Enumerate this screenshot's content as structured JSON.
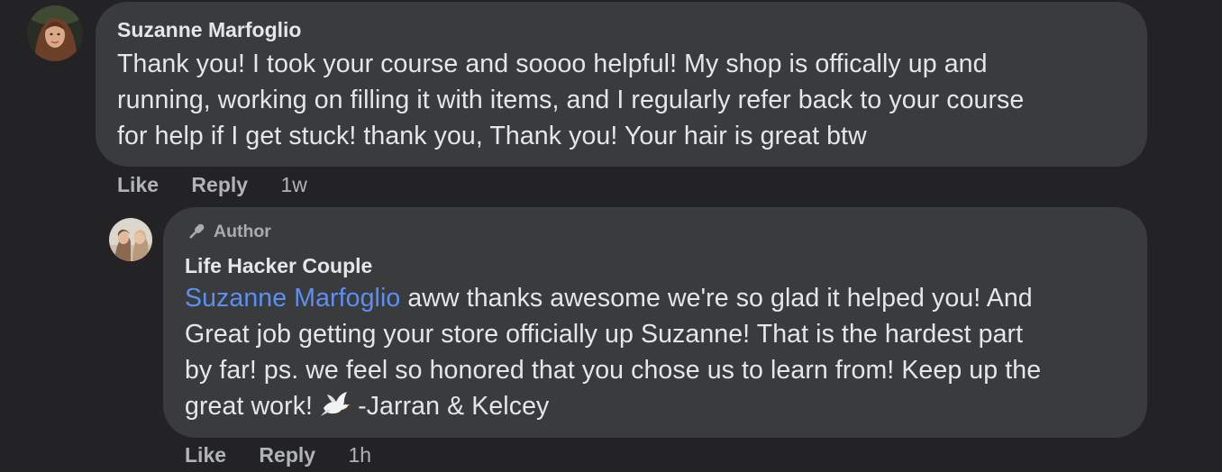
{
  "comment": {
    "author": "Suzanne Marfoglio",
    "text_lines": [
      "Thank you! I took your course and soooo helpful! My shop is offically up and",
      "running, working on filling it with items, and I regularly refer back to your course",
      "for help if I get stuck! thank you, Thank you! Your hair is great btw"
    ],
    "like_label": "Like",
    "reply_label": "Reply",
    "time": "1w"
  },
  "reply": {
    "badge": "Author",
    "author": "Life Hacker Couple",
    "mention": "Suzanne Marfoglio",
    "line1_rest": " aww thanks awesome we're so glad it helped you! And",
    "line2": "Great job getting your store officially up Suzanne! That is the hardest part",
    "line3": "by far! ps. we feel so honored that you chose us to learn from! Keep up the",
    "line4_start": "great work! ",
    "line4_end": " -Jarran & Kelcey",
    "like_label": "Like",
    "reply_label": "Reply",
    "time": "1h"
  },
  "icons": {
    "author_badge": "microphone-icon",
    "emoji": "dove-icon"
  },
  "colors": {
    "background": "#232325",
    "bubble": "#3a3b3d",
    "mention": "#5b8ff2",
    "secondary_text": "#b0b3b8"
  }
}
